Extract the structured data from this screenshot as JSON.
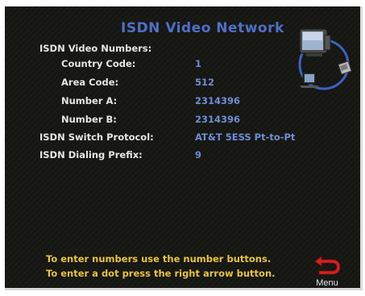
{
  "title": "ISDN Video Network",
  "section_label": "ISDN Video Numbers:",
  "fields": {
    "country_code": {
      "label": "Country Code:",
      "value": "1"
    },
    "area_code": {
      "label": "Area Code:",
      "value": "512"
    },
    "number_a": {
      "label": "Number A:",
      "value": "2314396"
    },
    "number_b": {
      "label": "Number B:",
      "value": "2314396"
    },
    "switch_protocol": {
      "label": "ISDN Switch Protocol:",
      "value": "AT&T 5ESS Pt-to-Pt"
    },
    "dialing_prefix": {
      "label": "ISDN Dialing Prefix:",
      "value": "9"
    }
  },
  "hints": [
    "To enter numbers use the number buttons.",
    "To enter a dot press the right arrow button."
  ],
  "menu": {
    "label": "Menu",
    "icon": "return-arrow-icon"
  },
  "logo_icon": "video-conference-network-icon",
  "colors": {
    "background": "#151512",
    "title": "#4f6fc8",
    "label": "#e6e6e6",
    "value": "#6f8ed6",
    "hint": "#e7c43a",
    "menu_arrow": "#d42020"
  }
}
